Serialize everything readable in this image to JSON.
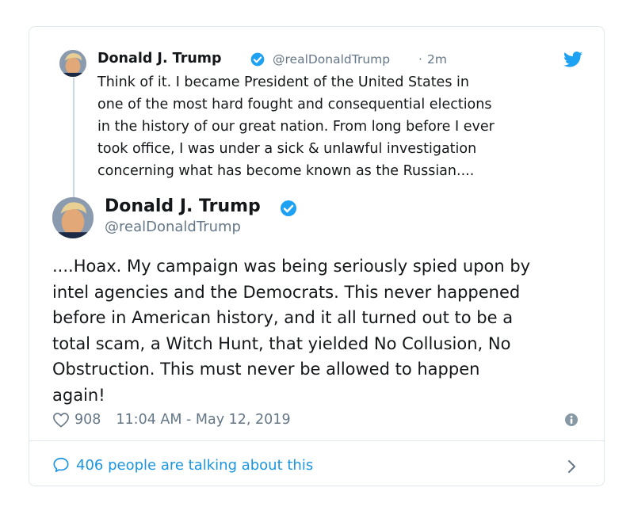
{
  "quoted_tweet": {
    "author_name": "Donald J. Trump",
    "handle": "@realDonaldTrump",
    "separator": "·",
    "time": "2m",
    "text_lines": [
      "Think of it. I became President of the United States in",
      "one of the most hard fought and consequential elections",
      "in the history of our great nation. From long before I ever",
      "took office, I was under a sick & unlawful investigation",
      "concerning what has become known as the Russian...."
    ]
  },
  "main_tweet": {
    "author_name": "Donald J. Trump",
    "handle": "@realDonaldTrump",
    "text_lines": [
      "....Hoax. My campaign was being seriously spied upon by",
      "intel agencies and the Democrats. This never happened",
      "before in American history, and it all turned out to be a",
      "total scam, a Witch Hunt, that yielded No Collusion, No",
      "Obstruction. This must never be allowed to happen",
      "again!"
    ],
    "likes": "908",
    "timestamp": "11:04 AM - May 12, 2019"
  },
  "footer": {
    "talking_text": "406 people are talking about this"
  },
  "icons": {
    "verified": "verified-badge-icon",
    "brand": "twitter-bird-icon",
    "like": "heart-icon",
    "info": "info-icon",
    "comment": "speech-bubble-icon",
    "more": "chevron-right-icon"
  },
  "colors": {
    "accent": "#1da1f2",
    "link": "#1b95e0",
    "muted": "#657786",
    "text": "#14171a",
    "border": "#e1e8ed"
  }
}
